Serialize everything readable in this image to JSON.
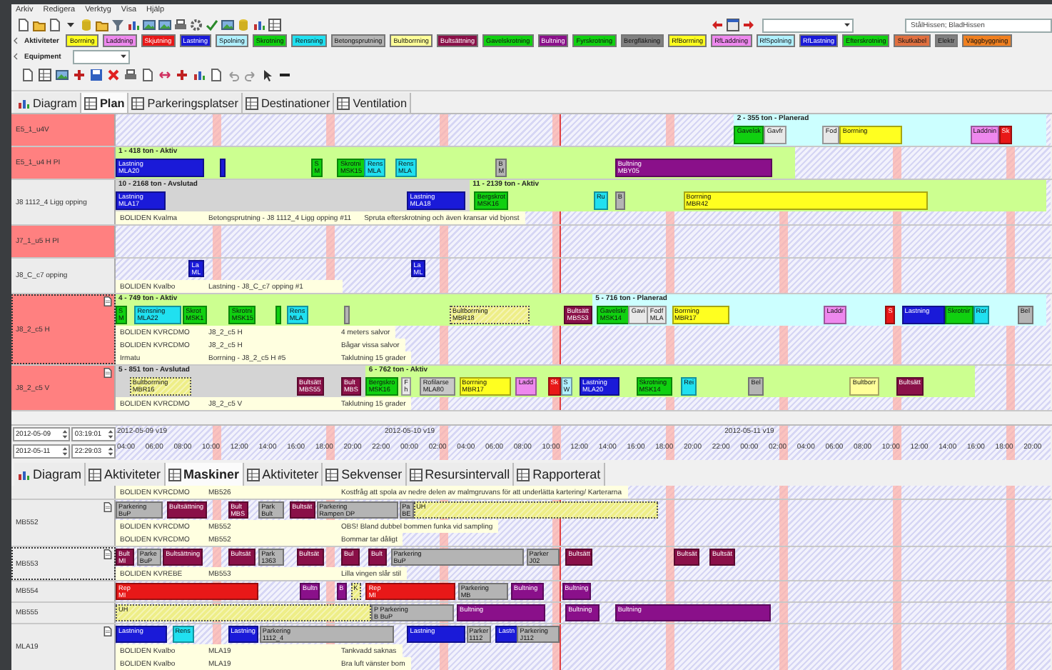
{
  "menu": [
    "Arkiv",
    "Redigera",
    "Verktyg",
    "Visa",
    "Hjälp"
  ],
  "search_field": {
    "value": "StålHissen; BladHissen"
  },
  "legend": {
    "label": "Aktiviteter",
    "items": [
      {
        "label": "Borrning",
        "color": "#ffff20"
      },
      {
        "label": "Laddning",
        "color": "#ee88ee"
      },
      {
        "label": "Skjutning",
        "color": "#e81818"
      },
      {
        "label": "Lastning",
        "color": "#1a1ad8"
      },
      {
        "label": "Spolning",
        "color": "#b0f0ff"
      },
      {
        "label": "Skrotning",
        "color": "#10d010"
      },
      {
        "label": "Rensning",
        "color": "#20e0f0"
      },
      {
        "label": "Betongsprutning",
        "color": "#b4b4b4"
      },
      {
        "label": "Bultborrning",
        "color": "#ffff99"
      },
      {
        "label": "Bultsättning",
        "color": "#8a1048"
      },
      {
        "label": "Gavelskrotning",
        "color": "#10d010"
      },
      {
        "label": "Bultning",
        "color": "#8a108a"
      },
      {
        "label": "Fyrskrotning",
        "color": "#10d010"
      },
      {
        "label": "Bergfläkning",
        "color": "#808080"
      },
      {
        "label": "RfBorrning",
        "color": "#ffff20"
      },
      {
        "label": "RfLaddning",
        "color": "#ee88ee"
      },
      {
        "label": "RfSpolning",
        "color": "#b0f0ff"
      },
      {
        "label": "RfLastning",
        "color": "#1a1ad8"
      },
      {
        "label": "Efterskrotning",
        "color": "#10d010"
      },
      {
        "label": "Skutkabel",
        "color": "#e07040"
      },
      {
        "label": "Elektr",
        "color": "#808080"
      },
      {
        "label": "Väggbyggning",
        "color": "#f08020"
      }
    ]
  },
  "equipment": {
    "label": "Equipment"
  },
  "upper_tabs": [
    {
      "label": "Diagram",
      "selected": false
    },
    {
      "label": "Plan",
      "selected": true
    },
    {
      "label": "Parkeringsplatser",
      "selected": false
    },
    {
      "label": "Destinationer",
      "selected": false
    },
    {
      "label": "Ventilation",
      "selected": false
    }
  ],
  "upper_rows": [
    {
      "label": "E5_1_u4V",
      "highlight": true,
      "selected": false,
      "attachment": false,
      "bands": [
        {
          "title": "2 - 355 ton - Planerad",
          "kind": "planned"
        }
      ],
      "bars": [
        {
          "lines": [
            "Gavelsk"
          ],
          "color": "#10d010",
          "hatched": false
        },
        {
          "lines": [
            "Gavfr"
          ],
          "color": "#e8e8e8",
          "hatched": false
        },
        {
          "lines": [
            "Fod"
          ],
          "color": "#e8e8e8",
          "hatched": false
        },
        {
          "lines": [
            "Borrning"
          ],
          "color": "#ffff20",
          "hatched": false
        },
        {
          "lines": [
            "Laddnin"
          ],
          "color": "#ee88ee",
          "hatched": false
        },
        {
          "lines": [
            "Sk"
          ],
          "color": "#e81818",
          "hatched": false
        }
      ]
    },
    {
      "label": "E5_1_u4 H PI",
      "highlight": true,
      "selected": false,
      "attachment": false,
      "bands": [
        {
          "title": "1 - 418 ton - Aktiv",
          "kind": "active"
        }
      ],
      "bars": [
        {
          "lines": [
            "Lastning",
            "MLA20"
          ],
          "color": "#1a1ad8",
          "hatched": false
        },
        {
          "color": "#1a1ad8",
          "hatched": false
        },
        {
          "lines": [
            "S",
            "M"
          ],
          "color": "#10d010",
          "hatched": false
        },
        {
          "lines": [
            "Skrotni",
            "MSK15"
          ],
          "color": "#10d010",
          "hatched": false
        },
        {
          "lines": [
            "Rens",
            "MLA"
          ],
          "color": "#20e0f0",
          "hatched": false
        },
        {
          "lines": [
            "Rens",
            "MLA"
          ],
          "color": "#20e0f0",
          "hatched": false
        },
        {
          "lines": [
            "B",
            "M"
          ],
          "color": "#b4b4b4",
          "hatched": false
        },
        {
          "lines": [
            "Bultning",
            "MBY05"
          ],
          "color": "#8a108a",
          "hatched": false
        }
      ]
    },
    {
      "label": "J8 1112_4 Ligg opping",
      "highlight": false,
      "selected": false,
      "attachment": false,
      "bands": [
        {
          "title": "10 - 2168 ton - Avslutad",
          "kind": "finished"
        },
        {
          "title": "11 - 2139 ton - Aktiv",
          "kind": "active"
        }
      ],
      "bars": [
        {
          "lines": [
            "Lastning",
            "MLA17"
          ],
          "color": "#1a1ad8",
          "hatched": false
        },
        {
          "lines": [
            "Lastning",
            "MLA18"
          ],
          "color": "#1a1ad8",
          "hatched": false
        },
        {
          "lines": [
            "Bergskrot",
            "MSK16"
          ],
          "color": "#10d010",
          "hatched": false
        },
        {
          "lines": [
            "Ru"
          ],
          "color": "#20e0f0",
          "hatched": false
        },
        {
          "lines": [
            "B"
          ],
          "color": "#b4b4b4",
          "hatched": false
        },
        {
          "lines": [
            "Borrning",
            "MBR42"
          ],
          "color": "#ffff20",
          "hatched": false
        }
      ],
      "notes": [
        [
          "BOLIDEN Kvalma",
          "Betongsprutning - J8 1112_4 Ligg opping #11",
          "Spruta efterskrotning och även kransar vid bjonst"
        ]
      ]
    },
    {
      "label": "J7_1_u5 H PI",
      "highlight": true,
      "selected": false,
      "attachment": false
    },
    {
      "label": "J8_C_c7 opping",
      "highlight": false,
      "selected": false,
      "attachment": false,
      "bars": [
        {
          "lines": [
            "La",
            "ML"
          ],
          "color": "#1a1ad8",
          "hatched": false
        },
        {
          "lines": [
            "La",
            "ML"
          ],
          "color": "#1a1ad8",
          "hatched": false
        }
      ],
      "notes": [
        [
          "BOLIDEN Kvalbo",
          "Lastning - J8_C_c7 opping #1"
        ]
      ]
    },
    {
      "label": "J8_2_c5 H",
      "highlight": true,
      "selected": true,
      "attachment": true,
      "bands": [
        {
          "title": "4 - 749 ton - Aktiv",
          "kind": "active"
        },
        {
          "title": "5 - 716 ton - Planerad",
          "kind": "planned"
        }
      ],
      "bars": [
        {
          "lines": [
            "S",
            "M"
          ],
          "color": "#10d010",
          "hatched": false
        },
        {
          "lines": [
            "Rensning",
            "MLA22"
          ],
          "color": "#20e0f0",
          "hatched": false
        },
        {
          "lines": [
            "Skrot",
            "MSK1"
          ],
          "color": "#10d010",
          "hatched": false
        },
        {
          "lines": [
            "Skrotni",
            "MSK15"
          ],
          "color": "#10d010",
          "hatched": false
        },
        {
          "color": "#10d010",
          "hatched": false
        },
        {
          "lines": [
            "Rens",
            "MLA"
          ],
          "color": "#20e0f0",
          "hatched": false
        },
        {
          "color": "#b4b4b4",
          "hatched": false
        },
        {
          "lines": [
            "Bultborrning",
            "MBR18"
          ],
          "color": "#eeee88",
          "hatched": true
        },
        {
          "lines": [
            "Bultsätt",
            "MBS53"
          ],
          "color": "#8a1048",
          "hatched": false
        },
        {
          "lines": [
            "Gavelskr",
            "MSK14"
          ],
          "color": "#10d010",
          "hatched": false
        },
        {
          "lines": [
            "Gavi"
          ],
          "color": "#e8e8e8",
          "hatched": false
        },
        {
          "lines": [
            "Fodf",
            "MLA"
          ],
          "color": "#e8e8e8",
          "hatched": false
        },
        {
          "lines": [
            "Borrning",
            "MBR17"
          ],
          "color": "#ffff20",
          "hatched": false
        },
        {
          "lines": [
            "Laddr"
          ],
          "color": "#ee88ee",
          "hatched": false
        },
        {
          "lines": [
            "S"
          ],
          "color": "#e81818",
          "hatched": false
        },
        {
          "lines": [
            "Lastning"
          ],
          "color": "#1a1ad8",
          "hatched": false
        },
        {
          "lines": [
            "Skrotnir"
          ],
          "color": "#10d010",
          "hatched": false
        },
        {
          "lines": [
            "Ror"
          ],
          "color": "#20e0f0",
          "hatched": false
        },
        {
          "lines": [
            "Bel"
          ],
          "color": "#b4b4b4",
          "hatched": false
        }
      ],
      "notes": [
        [
          "BOLIDEN KVRCDMO",
          "J8_2_c5 H",
          "4 meters salvor"
        ],
        [
          "BOLIDEN KVRCDMO",
          "J8_2_c5 H",
          "Bågar vissa salvor"
        ],
        [
          "Irmatu",
          "Borrning - J8_2_c5 H #5",
          "Taklutning 15 grader"
        ]
      ]
    },
    {
      "label": "J8_2_c5 V",
      "highlight": true,
      "selected": false,
      "attachment": true,
      "bands": [
        {
          "title": "5 - 851 ton - Avslutad",
          "kind": "finished"
        },
        {
          "title": "6 - 762 ton - Aktiv",
          "kind": "active"
        }
      ],
      "bars": [
        {
          "lines": [
            "Bultborrning",
            "MBR16"
          ],
          "color": "#eeee88",
          "hatched": true
        },
        {
          "lines": [
            "Bultsätt",
            "MBS55"
          ],
          "color": "#8a1048",
          "hatched": false
        },
        {
          "lines": [
            "Bult",
            "MBS"
          ],
          "color": "#8a1048",
          "hatched": false
        },
        {
          "lines": [
            "Bergskro",
            "MSK16"
          ],
          "color": "#10d010",
          "hatched": false
        },
        {
          "lines": [
            "F",
            "h"
          ],
          "color": "#e8e8e8",
          "hatched": false
        },
        {
          "lines": [
            "Rofilarse",
            "MLA80"
          ],
          "color": "#c8c8c8",
          "hatched": false
        },
        {
          "lines": [
            "Borrning",
            "MBR17"
          ],
          "color": "#ffff20",
          "hatched": false
        },
        {
          "lines": [
            "Ladd"
          ],
          "color": "#ee88ee",
          "hatched": false
        },
        {
          "lines": [
            "Sk"
          ],
          "color": "#e81818",
          "hatched": false
        },
        {
          "lines": [
            "S",
            "W"
          ],
          "color": "#b0f0ff",
          "hatched": false
        },
        {
          "lines": [
            "Lastning",
            "MLA20"
          ],
          "color": "#1a1ad8",
          "hatched": false
        },
        {
          "lines": [
            "Skrotning",
            "MSK14"
          ],
          "color": "#10d010",
          "hatched": false
        },
        {
          "lines": [
            "Rei"
          ],
          "color": "#20e0f0",
          "hatched": false
        },
        {
          "lines": [
            "Bel"
          ],
          "color": "#b4b4b4",
          "hatched": false
        },
        {
          "lines": [
            "Bultborr"
          ],
          "color": "#ffff99",
          "hatched": false
        },
        {
          "lines": [
            "Bultsätt"
          ],
          "color": "#8a1048",
          "hatched": false
        }
      ],
      "notes": [
        [
          "BOLIDEN KVRCDMO",
          "J8_2_c5 V",
          "Taklutning 15 grader"
        ]
      ]
    }
  ],
  "range": {
    "from_date": "2012-05-09",
    "from_time": "03:19:01",
    "to_date": "2012-05-11",
    "to_time": "22:29:03"
  },
  "timeline": {
    "days": [
      "2012-05-09 v19",
      "2012-05-10 v19",
      "2012-05-11 v19"
    ],
    "hours": [
      "04:00",
      "06:00",
      "08:00",
      "10:00",
      "12:00",
      "14:00",
      "16:00",
      "18:00",
      "20:00",
      "22:00",
      "00:00",
      "02:00",
      "04:00",
      "06:00",
      "08:00",
      "10:00",
      "12:00",
      "14:00",
      "16:00",
      "18:00",
      "20:00",
      "22:00",
      "00:00",
      "02:00",
      "04:00",
      "06:00",
      "08:00",
      "10:00",
      "12:00",
      "14:00",
      "16:00",
      "18:00",
      "20:00"
    ]
  },
  "lower_tabs": [
    {
      "label": "Diagram",
      "selected": false
    },
    {
      "label": "Aktiviteter",
      "selected": false
    },
    {
      "label": "Maskiner",
      "selected": true
    },
    {
      "label": "Aktiviteter",
      "selected": false
    },
    {
      "label": "Sekvenser",
      "selected": false
    },
    {
      "label": "Resursintervall",
      "selected": false
    },
    {
      "label": "Rapporterat",
      "selected": false
    }
  ],
  "lower_rows": [
    {
      "highlight": false,
      "selected": false,
      "attachment": false,
      "notes": [
        [
          "BOLIDEN KVRCDMO",
          "MB526",
          "Kostfråg att spola av nedre delen av malmgruvans för att underlätta kartering/ Karterarna"
        ]
      ]
    },
    {
      "label": "MB552",
      "highlight": false,
      "selected": false,
      "attachment": true,
      "bars": [
        {
          "lines": [
            "Parkering",
            "BuP"
          ],
          "color": "#b4b4b4",
          "hatched": false
        },
        {
          "lines": [
            "Bultsättning"
          ],
          "color": "#8a1048",
          "hatched": false
        },
        {
          "lines": [
            "Bult",
            "MBS"
          ],
          "color": "#8a1048",
          "hatched": false
        },
        {
          "lines": [
            "Park",
            "Bult"
          ],
          "color": "#b4b4b4",
          "hatched": false
        },
        {
          "lines": [
            "Bultsät"
          ],
          "color": "#8a1048",
          "hatched": false
        },
        {
          "lines": [
            "Parkering",
            "Rampen DP"
          ],
          "color": "#b4b4b4",
          "hatched": false
        },
        {
          "lines": [
            "Pa",
            "BE"
          ],
          "color": "#b4b4b4",
          "hatched": false
        },
        {
          "lines": [
            "UH"
          ],
          "color": "#eeee88",
          "hatched": true
        }
      ],
      "notes": [
        [
          "BOLIDEN KVRCDMO",
          "MB552",
          "OBS! Bland dubbel bommen funka vid sampling"
        ],
        [
          "BOLIDEN KVRCDMO",
          "MB552",
          "Bommar tar dåligt"
        ]
      ]
    },
    {
      "label": "MB553",
      "highlight": false,
      "selected": true,
      "attachment": true,
      "bars": [
        {
          "lines": [
            "Bult",
            "MI"
          ],
          "color": "#8a1048",
          "hatched": false
        },
        {
          "lines": [
            "Parke",
            "BuP"
          ],
          "color": "#b4b4b4",
          "hatched": false
        },
        {
          "lines": [
            "Bultsättning"
          ],
          "color": "#8a1048",
          "hatched": false
        },
        {
          "lines": [
            "Bultsät"
          ],
          "color": "#8a1048",
          "hatched": false
        },
        {
          "lines": [
            "Park",
            "1363"
          ],
          "color": "#b4b4b4",
          "hatched": false
        },
        {
          "lines": [
            "Bultsät"
          ],
          "color": "#8a1048",
          "hatched": false
        },
        {
          "lines": [
            "Bul"
          ],
          "color": "#8a1048",
          "hatched": false
        },
        {
          "lines": [
            "Bult"
          ],
          "color": "#8a1048",
          "hatched": false
        },
        {
          "lines": [
            "Parkering",
            "BuP"
          ],
          "color": "#b4b4b4",
          "hatched": false
        },
        {
          "lines": [
            "Parker",
            "J02"
          ],
          "color": "#b4b4b4",
          "hatched": false
        },
        {
          "lines": [
            "Bultsätt"
          ],
          "color": "#8a1048",
          "hatched": false
        },
        {
          "lines": [
            "Bultsät"
          ],
          "color": "#8a1048",
          "hatched": false
        },
        {
          "lines": [
            "Bultsät"
          ],
          "color": "#8a1048",
          "hatched": false
        }
      ],
      "notes": [
        [
          "BOLIDEN KVREBE",
          "MB553",
          "Lilla vingen slår stil"
        ]
      ]
    },
    {
      "label": "MB554",
      "highlight": false,
      "selected": false,
      "attachment": false,
      "bars": [
        {
          "lines": [
            "Rep",
            "MI"
          ],
          "color": "#e81818",
          "hatched": false
        },
        {
          "lines": [
            "Bultn"
          ],
          "color": "#8a108a",
          "hatched": false
        },
        {
          "lines": [
            "B"
          ],
          "color": "#8a108a",
          "hatched": false
        },
        {
          "lines": [
            "K"
          ],
          "color": "#eeee88",
          "hatched": true
        },
        {
          "lines": [
            "Rep",
            "MI"
          ],
          "color": "#e81818",
          "hatched": false
        },
        {
          "lines": [
            "Parkering",
            "MB"
          ],
          "color": "#b4b4b4",
          "hatched": false
        },
        {
          "lines": [
            "Bultning"
          ],
          "color": "#8a108a",
          "hatched": false
        },
        {
          "lines": [
            "Bultning"
          ],
          "color": "#8a108a",
          "hatched": false
        }
      ]
    },
    {
      "label": "MB555",
      "highlight": false,
      "selected": false,
      "attachment": false,
      "bars": [
        {
          "lines": [
            "UH"
          ],
          "color": "#eeee88",
          "hatched": true
        },
        {
          "lines": [
            "P Parkering",
            "B BuP"
          ],
          "color": "#b4b4b4",
          "hatched": false
        },
        {
          "lines": [
            "Bultning"
          ],
          "color": "#8a108a",
          "hatched": false
        },
        {
          "lines": [
            "Bultning"
          ],
          "color": "#8a108a",
          "hatched": false
        },
        {
          "lines": [
            "Bultning"
          ],
          "color": "#8a108a",
          "hatched": false
        }
      ]
    },
    {
      "label": "MLA19",
      "highlight": false,
      "selected": false,
      "attachment": true,
      "bars": [
        {
          "lines": [
            "Lastning"
          ],
          "color": "#1a1ad8",
          "hatched": false
        },
        {
          "lines": [
            "Rens"
          ],
          "color": "#20e0f0",
          "hatched": false
        },
        {
          "lines": [
            "Lastning"
          ],
          "color": "#1a1ad8",
          "hatched": false
        },
        {
          "lines": [
            "Parkering",
            "1112_4"
          ],
          "color": "#b4b4b4",
          "hatched": false
        },
        {
          "lines": [
            "Lastning"
          ],
          "color": "#1a1ad8",
          "hatched": false
        },
        {
          "lines": [
            "Parker",
            "1112"
          ],
          "color": "#b4b4b4",
          "hatched": false
        },
        {
          "lines": [
            "Lastn"
          ],
          "color": "#1a1ad8",
          "hatched": false
        },
        {
          "lines": [
            "Parkering",
            "J112"
          ],
          "color": "#b4b4b4",
          "hatched": false
        }
      ],
      "notes": [
        [
          "BOLIDEN Kvalbo",
          "MLA19",
          "Tankvadd saknas"
        ],
        [
          "BOLIDEN Kvalbo",
          "MLA19",
          "Bra luft vänster bom"
        ]
      ]
    }
  ]
}
